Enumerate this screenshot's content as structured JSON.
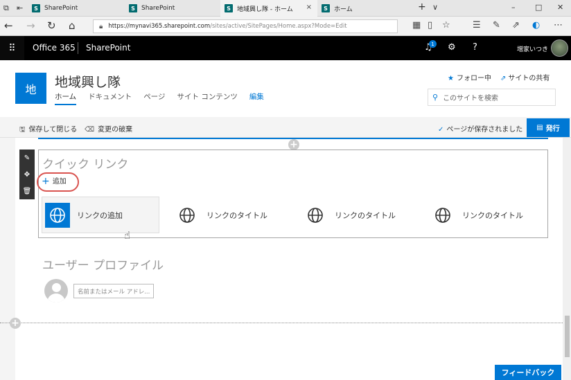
{
  "browser": {
    "tabs": [
      {
        "title": "SharePoint",
        "icon": "S"
      },
      {
        "title": "SharePoint",
        "icon": "S"
      },
      {
        "title": "地域興し隊 - ホーム",
        "icon": "S",
        "close": "×"
      },
      {
        "title": "ホーム",
        "icon": "S"
      }
    ],
    "new_tab": "+",
    "tab_list": "∨",
    "minimize": "–",
    "maximize": "□",
    "close": "✕",
    "url_host": "https://mynavi365.sharepoint.com",
    "url_path": "/sites/active/SitePages/Home.aspx?Mode=Edit"
  },
  "suite": {
    "app_launcher": "⠿",
    "brand": "Office 365",
    "app": "SharePoint",
    "notification_count": "1",
    "help": "?",
    "user_name": "増家いつき"
  },
  "site": {
    "logo_text": "地",
    "title": "地域興し隊",
    "nav": [
      "ホーム",
      "ドキュメント",
      "ページ",
      "サイト コンテンツ"
    ],
    "nav_edit": "編集",
    "follow": "フォロー中",
    "share": "サイトの共有",
    "search_placeholder": "このサイトを検索"
  },
  "command": {
    "save_close": "保存して閉じる",
    "discard": "変更の破棄",
    "saved_status": "ページが保存されました",
    "publish": "発行"
  },
  "quick_links": {
    "title": "クイック リンク",
    "add": "追加",
    "links": [
      "リンクの追加",
      "リンクのタイトル",
      "リンクのタイトル",
      "リンクのタイトル"
    ]
  },
  "user_profile": {
    "title": "ユーザー プロファイル",
    "placeholder": "名前またはメール アドレ..."
  },
  "feedback": "フィードバック",
  "colors": {
    "accent": "#0078d4",
    "highlight": "#d9534f",
    "suite_bg": "#000000"
  }
}
